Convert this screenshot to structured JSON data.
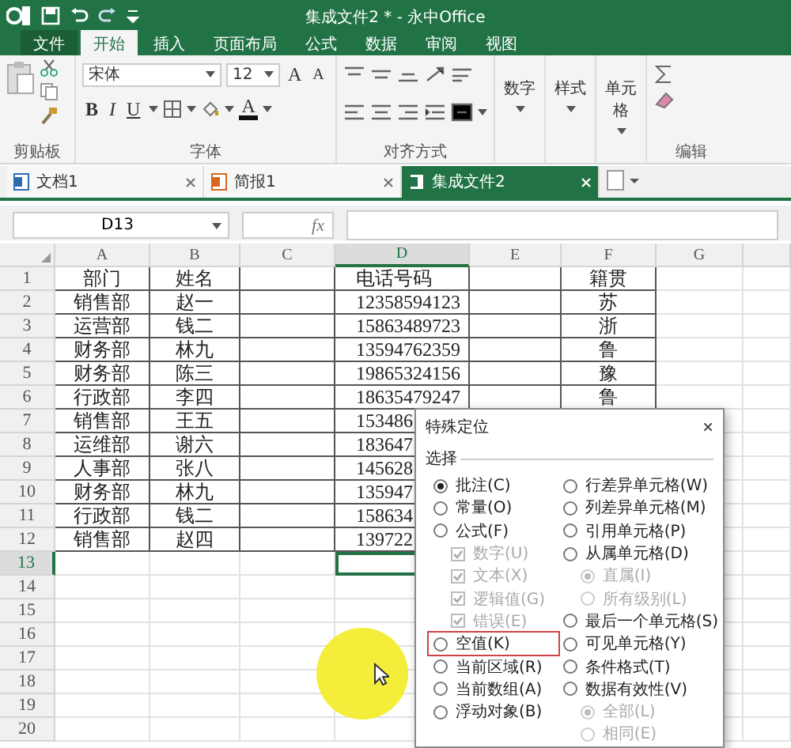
{
  "title_bar": {
    "title": "集成文件2 * - 永中Office"
  },
  "ribbon_tabs": [
    {
      "label": "文件",
      "kind": "file",
      "selected": false
    },
    {
      "label": "开始",
      "kind": "tab",
      "selected": true
    },
    {
      "label": "插入",
      "kind": "tab",
      "selected": false
    },
    {
      "label": "页面布局",
      "kind": "tab",
      "selected": false
    },
    {
      "label": "公式",
      "kind": "tab",
      "selected": false
    },
    {
      "label": "数据",
      "kind": "tab",
      "selected": false
    },
    {
      "label": "审阅",
      "kind": "tab",
      "selected": false
    },
    {
      "label": "视图",
      "kind": "tab",
      "selected": false
    }
  ],
  "ribbon": {
    "font_name": "宋体",
    "font_size": "12",
    "grow_font": "A",
    "shrink_font": "A",
    "bold": "B",
    "italic": "I",
    "underline": "U",
    "font_color": "A",
    "menu_buttons": [
      "数字",
      "样式",
      "单元格"
    ],
    "group_labels": [
      "剪贴板",
      "字体",
      "对齐方式",
      "编辑"
    ]
  },
  "doc_tabs": [
    {
      "label": "文档1",
      "kind": "writer",
      "selected": false
    },
    {
      "label": "简报1",
      "kind": "slides",
      "selected": false
    },
    {
      "label": "集成文件2",
      "kind": "sheet",
      "selected": true
    }
  ],
  "formula_bar": {
    "name_box": "D13",
    "fx": "fx"
  },
  "sheet": {
    "columns": [
      {
        "label": "A",
        "selected": false
      },
      {
        "label": "B",
        "selected": false
      },
      {
        "label": "C",
        "selected": false
      },
      {
        "label": "D",
        "selected": true
      },
      {
        "label": "E",
        "selected": false
      },
      {
        "label": "F",
        "selected": false
      },
      {
        "label": "G",
        "selected": false
      }
    ],
    "rows": [
      {
        "number": "1",
        "selected": false,
        "A": "部门",
        "B": "姓名",
        "D": "电话号码",
        "F": "籍贯"
      },
      {
        "number": "2",
        "selected": false,
        "A": "销售部",
        "B": "赵一",
        "D": "12358594123",
        "F": "苏"
      },
      {
        "number": "3",
        "selected": false,
        "A": "运营部",
        "B": "钱二",
        "D": "15863489723",
        "F": "浙"
      },
      {
        "number": "4",
        "selected": false,
        "A": "财务部",
        "B": "林九",
        "D": "13594762359",
        "F": "鲁"
      },
      {
        "number": "5",
        "selected": false,
        "A": "财务部",
        "B": "陈三",
        "D": "19865324156",
        "F": "豫"
      },
      {
        "number": "6",
        "selected": false,
        "A": "行政部",
        "B": "李四",
        "D": "18635479247",
        "F": "鲁"
      },
      {
        "number": "7",
        "selected": false,
        "A": "销售部",
        "B": "王五",
        "D": "153486"
      },
      {
        "number": "8",
        "selected": false,
        "A": "运维部",
        "B": "谢六",
        "D": "183647"
      },
      {
        "number": "9",
        "selected": false,
        "A": "人事部",
        "B": "张八",
        "D": "145628"
      },
      {
        "number": "10",
        "selected": false,
        "A": "财务部",
        "B": "林九",
        "D": "135947"
      },
      {
        "number": "11",
        "selected": false,
        "A": "行政部",
        "B": "钱二",
        "D": "158634"
      },
      {
        "number": "12",
        "selected": false,
        "A": "销售部",
        "B": "赵四",
        "D": "139722"
      },
      {
        "number": "13",
        "selected": true
      },
      {
        "number": "14",
        "selected": false
      },
      {
        "number": "15",
        "selected": false
      },
      {
        "number": "16",
        "selected": false
      },
      {
        "number": "17",
        "selected": false
      },
      {
        "number": "18",
        "selected": false
      },
      {
        "number": "19",
        "selected": false
      },
      {
        "number": "20",
        "selected": false
      }
    ]
  },
  "dialog": {
    "title": "特殊定位",
    "close": "×",
    "group_label": "选择",
    "left_options": [
      {
        "label": "批注(C)",
        "kind": "radio",
        "selected": true,
        "disabled": false,
        "highlighted": false
      },
      {
        "label": "常量(O)",
        "kind": "radio",
        "selected": false,
        "disabled": false,
        "highlighted": false
      },
      {
        "label": "公式(F)",
        "kind": "radio",
        "selected": false,
        "disabled": false,
        "highlighted": false,
        "children": [
          {
            "label": "数字(U)",
            "kind": "checkbox",
            "checked": true,
            "disabled": true
          },
          {
            "label": "文本(X)",
            "kind": "checkbox",
            "checked": true,
            "disabled": true
          },
          {
            "label": "逻辑值(G)",
            "kind": "checkbox",
            "checked": true,
            "disabled": true
          },
          {
            "label": "错误(E)",
            "kind": "checkbox",
            "checked": true,
            "disabled": true
          }
        ]
      },
      {
        "label": "空值(K)",
        "kind": "radio",
        "selected": false,
        "disabled": false,
        "highlighted": true
      },
      {
        "label": "当前区域(R)",
        "kind": "radio",
        "selected": false,
        "disabled": false,
        "highlighted": false
      },
      {
        "label": "当前数组(A)",
        "kind": "radio",
        "selected": false,
        "disabled": false,
        "highlighted": false
      },
      {
        "label": "浮动对象(B)",
        "kind": "radio",
        "selected": false,
        "disabled": false,
        "highlighted": false
      }
    ],
    "right_options": [
      {
        "label": "行差异单元格(W)",
        "kind": "radio",
        "selected": false,
        "disabled": false,
        "highlighted": false
      },
      {
        "label": "列差异单元格(M)",
        "kind": "radio",
        "selected": false,
        "disabled": false,
        "highlighted": false
      },
      {
        "label": "引用单元格(P)",
        "kind": "radio",
        "selected": false,
        "disabled": false,
        "highlighted": false
      },
      {
        "label": "从属单元格(D)",
        "kind": "radio",
        "selected": false,
        "disabled": false,
        "highlighted": false,
        "children": [
          {
            "label": "直属(I)",
            "kind": "radio",
            "selected": true,
            "disabled": true
          },
          {
            "label": "所有级别(L)",
            "kind": "radio",
            "selected": false,
            "disabled": true
          }
        ]
      },
      {
        "label": "最后一个单元格(S)",
        "kind": "radio",
        "selected": false,
        "disabled": false,
        "highlighted": false
      },
      {
        "label": "可见单元格(Y)",
        "kind": "radio",
        "selected": false,
        "disabled": false,
        "highlighted": false
      },
      {
        "label": "条件格式(T)",
        "kind": "radio",
        "selected": false,
        "disabled": false,
        "highlighted": false
      },
      {
        "label": "数据有效性(V)",
        "kind": "radio",
        "selected": false,
        "disabled": false,
        "highlighted": false,
        "children": [
          {
            "label": "全部(L)",
            "kind": "radio",
            "selected": true,
            "disabled": true
          },
          {
            "label": "相同(E)",
            "kind": "radio",
            "selected": false,
            "disabled": true
          }
        ]
      }
    ]
  }
}
